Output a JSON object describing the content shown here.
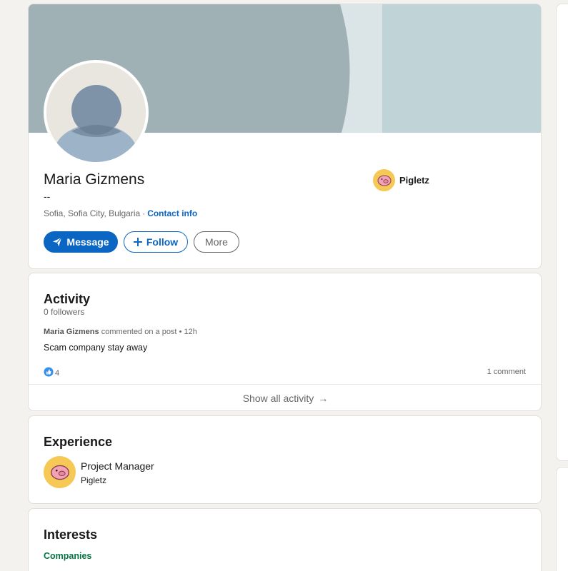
{
  "profile": {
    "name": "Maria Gizmens",
    "headline": "--",
    "location": "Sofia, Sofia City, Bulgaria",
    "separator": "·",
    "contact_info_label": "Contact info",
    "current_company": "Pigletz",
    "buttons": {
      "message": "Message",
      "follow": "Follow",
      "more": "More"
    }
  },
  "activity": {
    "title": "Activity",
    "followers": "0 followers",
    "post_author": "Maria Gizmens",
    "post_action": "commented on a post",
    "post_time": "• 12h",
    "post_text": "Scam company stay away",
    "reaction_count": "4",
    "comment_count": "1 comment",
    "show_all_label": "Show all activity",
    "show_all_arrow": "→"
  },
  "experience": {
    "title": "Experience",
    "items": [
      {
        "role": "Project Manager",
        "company": "Pigletz"
      }
    ]
  },
  "interests": {
    "title": "Interests",
    "active_tab": "Companies"
  },
  "colors": {
    "accent": "#0a66c2",
    "interest_tab": "#057642",
    "banner": "#9fb1b4",
    "company_logo": "#f6c957"
  },
  "icons": {
    "message_button": "paper-plane-icon",
    "follow_button": "plus-icon",
    "company_logo": "piglet-logo-icon",
    "reaction": "like-reaction-icon"
  }
}
